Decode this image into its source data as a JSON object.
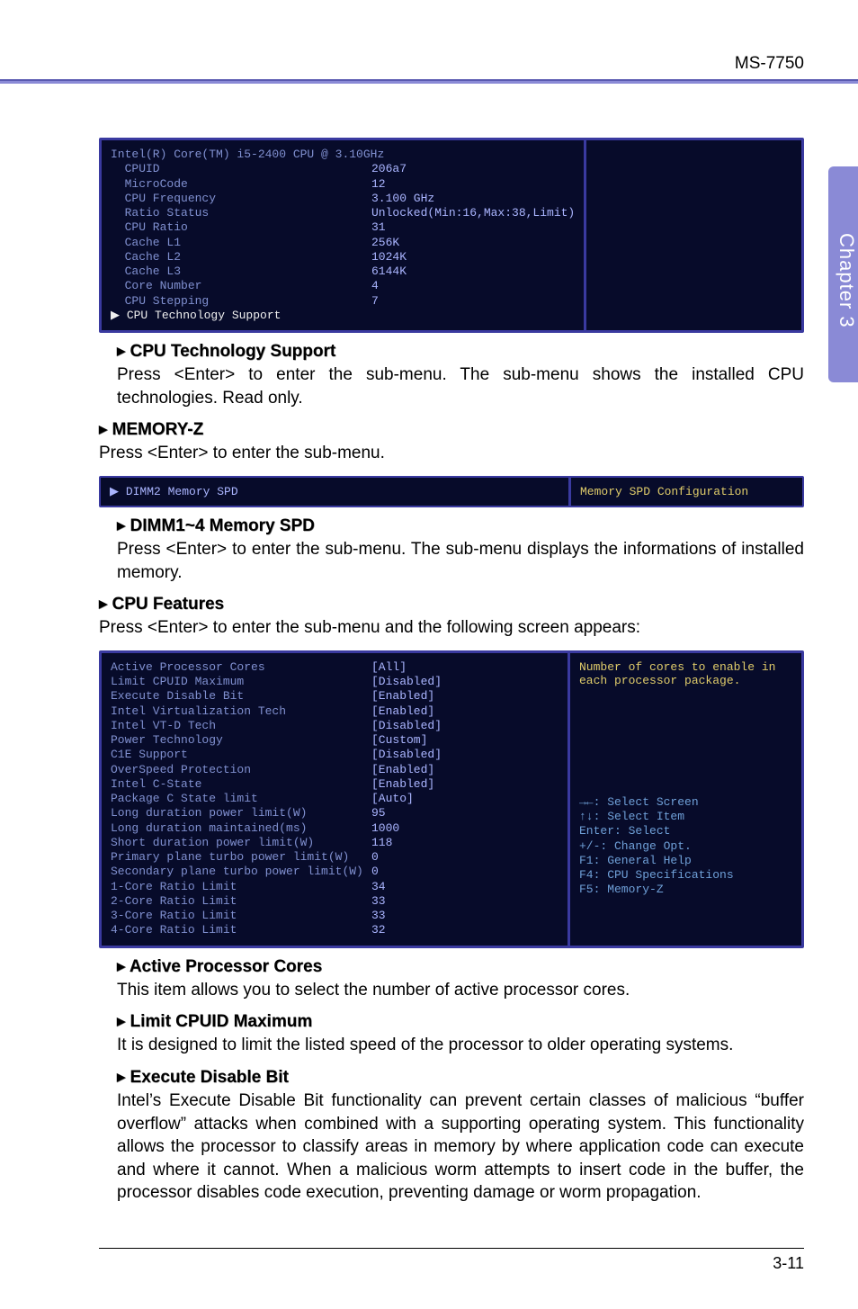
{
  "header": {
    "model": "MS-7750",
    "chapter": "Chapter 3",
    "page": "3-11"
  },
  "bios1": {
    "title": "Intel(R) Core(TM) i5-2400 CPU @ 3.10GHz",
    "rows": [
      {
        "k": "CPUID",
        "v": "206a7"
      },
      {
        "k": "MicroCode",
        "v": "12"
      },
      {
        "k": "CPU Frequency",
        "v": "3.100 GHz"
      },
      {
        "k": "Ratio Status",
        "v": "Unlocked(Min:16,Max:38,Limit)"
      },
      {
        "k": "CPU Ratio",
        "v": "31"
      },
      {
        "k": "Cache L1",
        "v": "256K"
      },
      {
        "k": "Cache L2",
        "v": "1024K"
      },
      {
        "k": "Cache L3",
        "v": "6144K"
      },
      {
        "k": "Core Number",
        "v": "4"
      },
      {
        "k": "CPU Stepping",
        "v": "7"
      }
    ],
    "highlight": "CPU Technology Support"
  },
  "sec_cpu_tech": {
    "title": "CPU Technology Support",
    "text": "Press <Enter> to enter the sub-menu. The sub-menu shows the installed CPU technologies. Read only."
  },
  "sec_memz": {
    "title": "MEMORY-Z",
    "text": "Press <Enter> to enter the sub-menu."
  },
  "bios2": {
    "left": "DIMM2 Memory SPD",
    "right": "Memory SPD Configuration"
  },
  "sec_dimm": {
    "title": "DIMM1~4 Memory SPD",
    "text": "Press <Enter> to enter the sub-menu. The sub-menu displays the informations of installed memory."
  },
  "sec_cpuf": {
    "title": "CPU Features",
    "text": "Press <Enter> to enter the sub-menu and the following screen appears:"
  },
  "bios3": {
    "rows": [
      {
        "k": "Active Processor Cores",
        "v": "[All]"
      },
      {
        "k": "Limit CPUID Maximum",
        "v": "[Disabled]"
      },
      {
        "k": "Execute Disable Bit",
        "v": "[Enabled]"
      },
      {
        "k": "Intel Virtualization Tech",
        "v": "[Enabled]"
      },
      {
        "k": "Intel VT-D Tech",
        "v": "[Disabled]"
      },
      {
        "k": "Power Technology",
        "v": "[Custom]"
      },
      {
        "k": "C1E Support",
        "v": "[Disabled]"
      },
      {
        "k": "OverSpeed Protection",
        "v": "[Enabled]"
      },
      {
        "k": "Intel C-State",
        "v": "[Enabled]"
      },
      {
        "k": "Package C State limit",
        "v": "[Auto]"
      },
      {
        "k": "Long duration power limit(W)",
        "v": "95"
      },
      {
        "k": "Long duration maintained(ms)",
        "v": "1000"
      },
      {
        "k": "Short duration power limit(W)",
        "v": "118"
      },
      {
        "k": "Primary plane turbo power limit(W)",
        "v": "0"
      },
      {
        "k": "Secondary plane turbo power limit(W)",
        "v": "0"
      },
      {
        "k": "1-Core Ratio Limit",
        "v": "34"
      },
      {
        "k": "2-Core Ratio Limit",
        "v": "33"
      },
      {
        "k": "3-Core Ratio Limit",
        "v": "33"
      },
      {
        "k": "4-Core Ratio Limit",
        "v": "32"
      }
    ],
    "help": "Number of cores to enable in each processor package.",
    "keys": [
      "→←: Select Screen",
      "↑↓: Select Item",
      "Enter: Select",
      "+/-: Change Opt.",
      "F1: General Help",
      "F4: CPU Specifications",
      "F5: Memory-Z"
    ]
  },
  "sec_apc": {
    "title": "Active Processor Cores",
    "text": "This item allows you to select the number of active processor cores."
  },
  "sec_lcm": {
    "title": "Limit CPUID Maximum",
    "text": "It is designed to limit the listed speed of the processor to older operating systems."
  },
  "sec_edb": {
    "title": "Execute Disable Bit",
    "text": "Intel’s Execute Disable Bit functionality can prevent certain classes of malicious “buffer overflow” attacks when combined with a supporting operating system. This functionality allows the processor to classify areas in memory by where application code can execute and where it cannot. When a malicious worm attempts to insert code in the buffer, the processor disables code execution, preventing damage or worm propagation."
  }
}
